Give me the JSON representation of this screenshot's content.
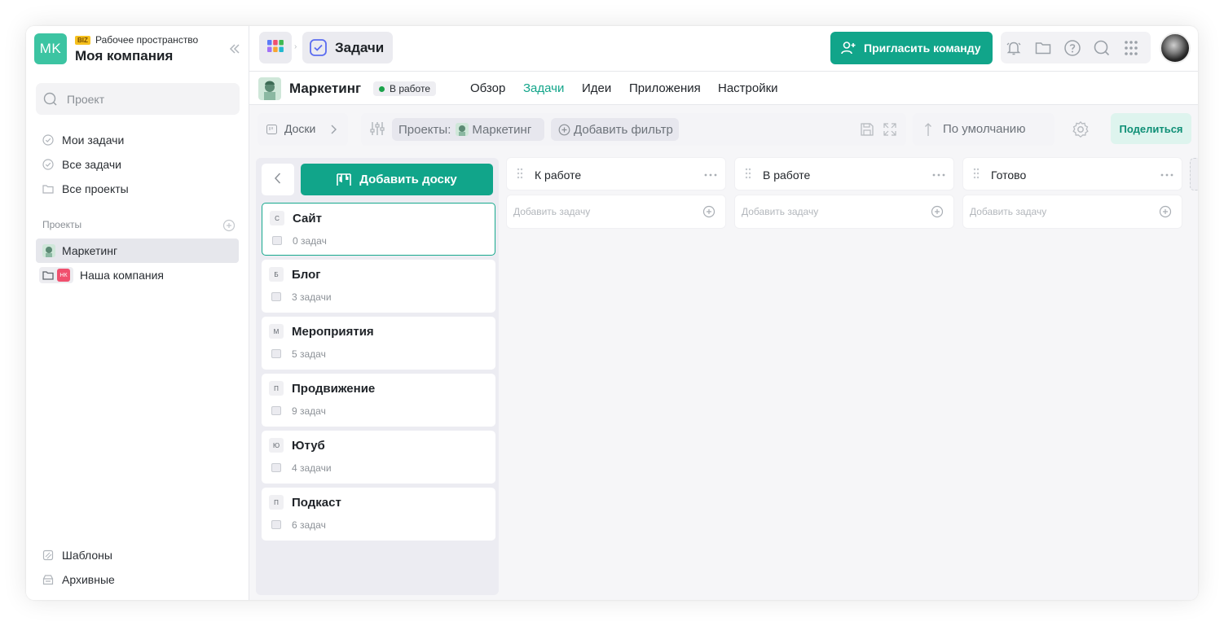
{
  "workspace": {
    "initials": "MK",
    "badge": "BIZ",
    "label": "Рабочее пространство",
    "name": "Моя компания"
  },
  "sidebar": {
    "search_placeholder": "Проект",
    "nav": [
      {
        "label": "Мои задачи",
        "icon": "check-circle-icon"
      },
      {
        "label": "Все задачи",
        "icon": "check-circle-icon"
      },
      {
        "label": "Все проекты",
        "icon": "folder-icon"
      }
    ],
    "section_title": "Проекты",
    "projects": [
      {
        "label": "Маркетинг",
        "active": true
      },
      {
        "label": "Наша компания",
        "badge": "НК"
      }
    ],
    "footer": [
      {
        "label": "Шаблоны",
        "icon": "templates-icon"
      },
      {
        "label": "Архивные",
        "icon": "archive-icon"
      }
    ]
  },
  "topbar": {
    "section_title": "Задачи",
    "invite_label": "Пригласить команду"
  },
  "project": {
    "name": "Маркетинг",
    "status": "В работе",
    "status_color": "#1aa24a",
    "tabs": [
      "Обзор",
      "Задачи",
      "Идеи",
      "Приложения",
      "Настройки"
    ],
    "active_tab": "Задачи"
  },
  "toolbar": {
    "boards_label": "Доски",
    "projects_label": "Проекты:",
    "project_chip": "Маркетинг",
    "add_filter_label": "Добавить фильтр",
    "sort_label": "По умолчанию",
    "share_label": "Поделиться"
  },
  "boards": {
    "add_label": "Добавить доску",
    "items": [
      {
        "letter": "С",
        "name": "Сайт",
        "count": "0 задач"
      },
      {
        "letter": "Б",
        "name": "Блог",
        "count": "3 задачи"
      },
      {
        "letter": "М",
        "name": "Мероприятия",
        "count": "5 задач"
      },
      {
        "letter": "П",
        "name": "Продвижение",
        "count": "9 задач"
      },
      {
        "letter": "Ю",
        "name": "Ютуб",
        "count": "4 задачи"
      },
      {
        "letter": "П",
        "name": "Подкаст",
        "count": "6 задач"
      }
    ]
  },
  "columns": [
    {
      "title": "К работе",
      "add_placeholder": "Добавить задачу"
    },
    {
      "title": "В работе",
      "add_placeholder": "Добавить задачу"
    },
    {
      "title": "Готово",
      "add_placeholder": "Добавить задачу"
    }
  ],
  "colors": {
    "accent": "#11a58a",
    "workspace_logo": "#3cc4a2",
    "active_tab": "#12a58a"
  }
}
